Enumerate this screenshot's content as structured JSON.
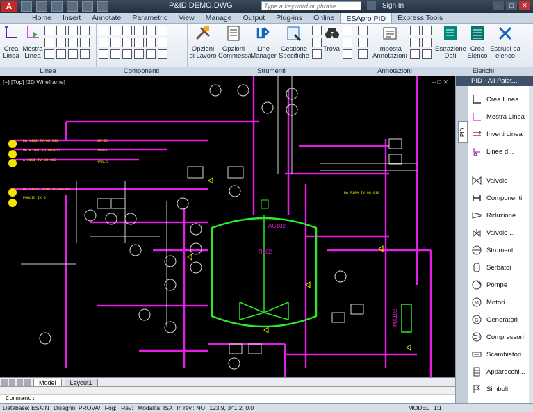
{
  "app": {
    "logo_letter": "A",
    "window_title": "P&ID DEMO.DWG",
    "search_placeholder": "Type a keyword or phrase",
    "sign_in": "Sign In"
  },
  "tabs": [
    "Home",
    "Insert",
    "Annotate",
    "Parametric",
    "View",
    "Manage",
    "Output",
    "Plug-ins",
    "Online",
    "ESApro PID",
    "Express Tools"
  ],
  "active_tab": "ESApro PID",
  "ribbon": {
    "linea": {
      "title": "Linea",
      "crea": "Crea Linea",
      "mostra": "Mostra Linea"
    },
    "componenti": {
      "title": "Componenti"
    },
    "strumenti": {
      "title": "Strumenti",
      "opzioni_lavoro": "Opzioni di Lavoro",
      "opzioni_commessa": "Opzioni Commessa",
      "line_manager": "Line Manager",
      "gestione": "Gestione Specifiche",
      "trova": "Trova"
    },
    "annotazioni": {
      "title": "Annotazioni",
      "imposta": "Imposta Annotazioni"
    },
    "elenchi": {
      "title": "Elenchi",
      "estrazione": "Estrazione Dati",
      "crea_elenco": "Crea Elenco",
      "escludi": "Escludi da elenco"
    }
  },
  "viewport": {
    "label": "[−] [Top] [2D Wireframe]",
    "equipment_labels": [
      "AG102",
      "R102",
      "MX102"
    ]
  },
  "layout_tabs": [
    "Model",
    "Layout1"
  ],
  "command": {
    "prompt": "Command:"
  },
  "status": {
    "database": "Database: ESAIN",
    "disegno": "Disegno: PROVA/",
    "foglio": "Fog:",
    "rev": "Rev:",
    "modalita": "Modalità: ISA",
    "in_rev": "In rev.: NO",
    "coords": "123.9, 341.2, 0.0",
    "space": "MODEL",
    "scale": "1:1"
  },
  "palette": {
    "title": "PID - All Palet...",
    "tab": "PID",
    "items": [
      {
        "label": "Crea Linea...",
        "icon": "line-create-icon"
      },
      {
        "label": "Mostra Linea",
        "icon": "line-show-icon"
      },
      {
        "label": "Inverti Linea",
        "icon": "line-reverse-icon"
      },
      {
        "label": "Linee d...",
        "icon": "line-other-icon"
      },
      {
        "label": "Valvole",
        "icon": "valve-icon"
      },
      {
        "label": "Componenti",
        "icon": "component-icon"
      },
      {
        "label": "Riduzione",
        "icon": "reducer-icon"
      },
      {
        "label": "Valvole ...",
        "icon": "valve-other-icon"
      },
      {
        "label": "Strumenti",
        "icon": "instrument-icon"
      },
      {
        "label": "Serbatoi",
        "icon": "tank-icon"
      },
      {
        "label": "Pompe",
        "icon": "pump-icon"
      },
      {
        "label": "Motori",
        "icon": "motor-icon"
      },
      {
        "label": "Generatori",
        "icon": "generator-icon"
      },
      {
        "label": "Compressori",
        "icon": "compressor-icon"
      },
      {
        "label": "Scambiatori",
        "icon": "exchanger-icon"
      },
      {
        "label": "Apparecchi...",
        "icon": "apparatus-icon"
      },
      {
        "label": "Simboli",
        "icon": "symbol-icon"
      }
    ]
  }
}
